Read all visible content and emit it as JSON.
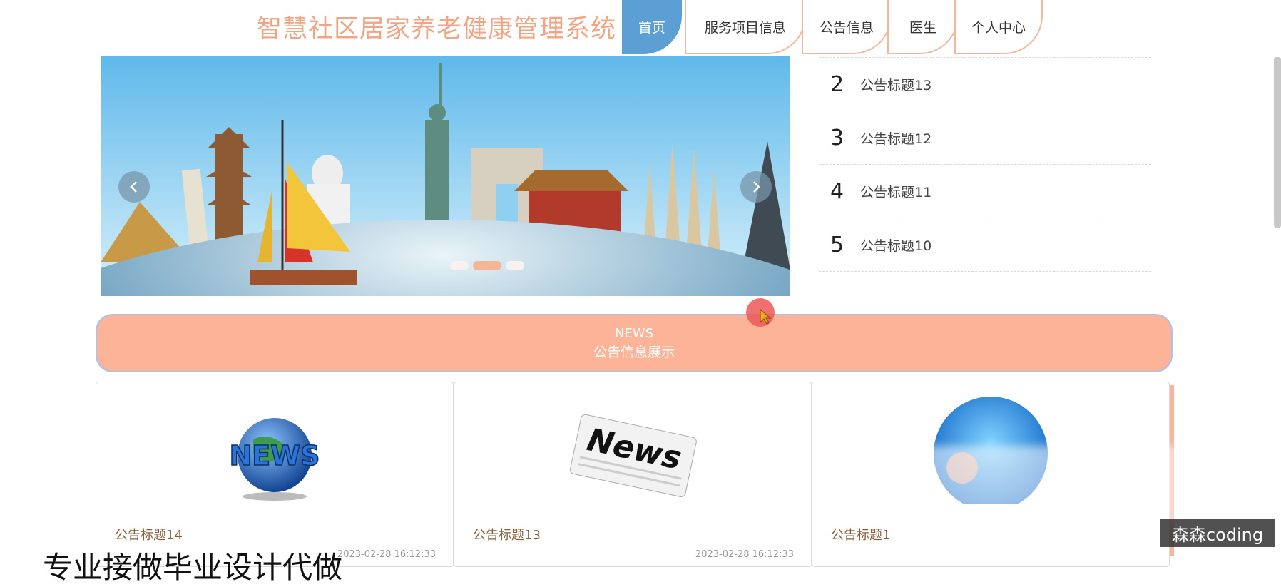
{
  "site_title": "智慧社区居家养老健康管理系统",
  "nav": {
    "tabs": [
      {
        "label": "首页",
        "active": true
      },
      {
        "label": "服务项目信息",
        "active": false
      },
      {
        "label": "公告信息",
        "active": false
      },
      {
        "label": "医生",
        "active": false
      },
      {
        "label": "个人中心",
        "active": false
      }
    ]
  },
  "carousel": {
    "prev_icon": "chevron-left-icon",
    "next_icon": "chevron-right-icon",
    "active_dot": 1,
    "dot_count": 3
  },
  "notices": [
    {
      "num": "2",
      "title": "公告标题13"
    },
    {
      "num": "3",
      "title": "公告标题12"
    },
    {
      "num": "4",
      "title": "公告标题11"
    },
    {
      "num": "5",
      "title": "公告标题10"
    }
  ],
  "news_section": {
    "en": "NEWS",
    "cn": "公告信息展示"
  },
  "news_cards": [
    {
      "title": "公告标题14",
      "date": "2023-02-28 16:12:33"
    },
    {
      "title": "公告标题13",
      "date": "2023-02-28 16:12:33"
    },
    {
      "title": "公告标题1",
      "date": ""
    }
  ],
  "watermark": "森森coding",
  "bottom_text": "专业接做毕业设计代做",
  "colors": {
    "accent": "#fcb398",
    "title": "#f2a584",
    "active_tab": "#5b9fd3"
  }
}
